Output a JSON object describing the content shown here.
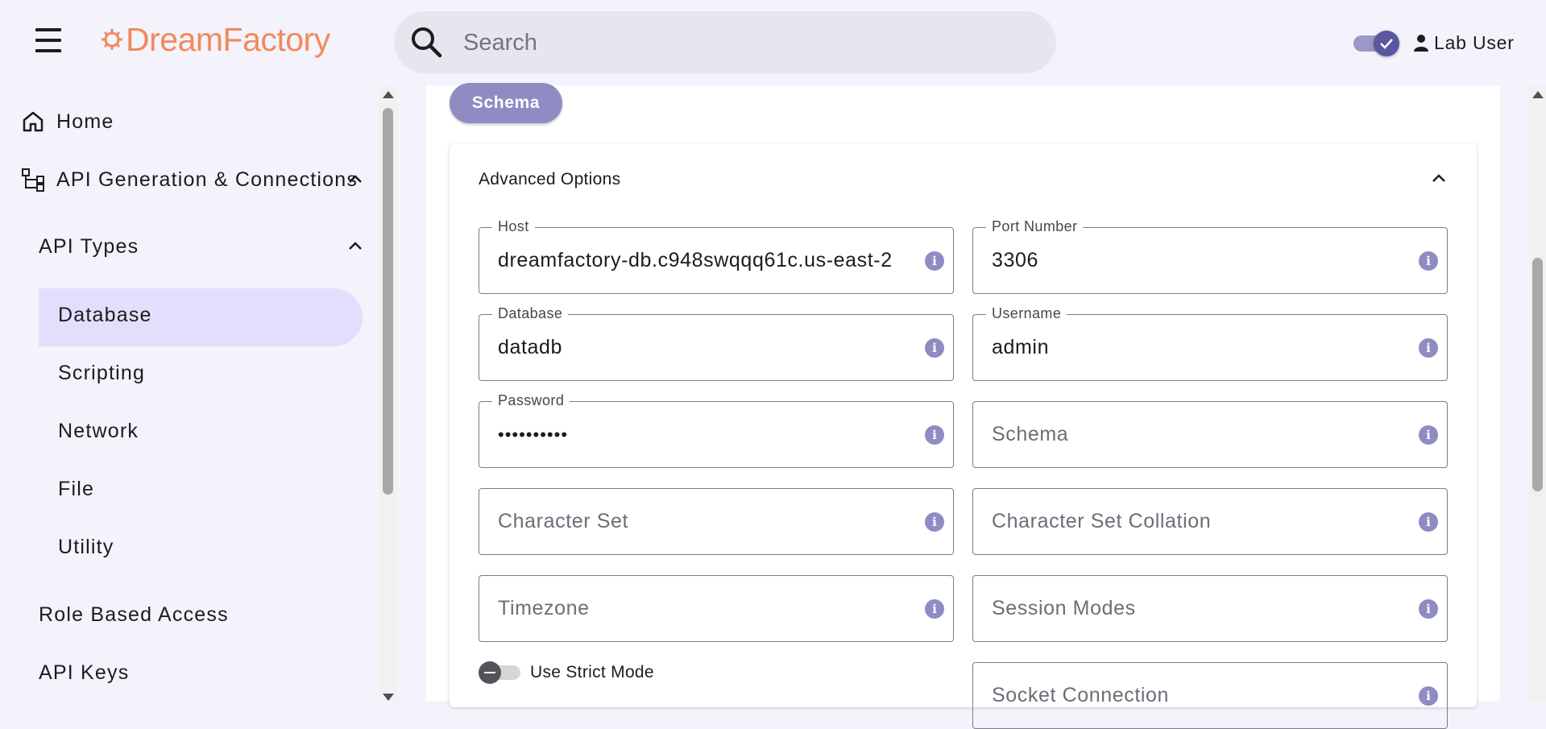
{
  "header": {
    "logo_text": "DreamFactory",
    "search_placeholder": "Search",
    "user_name": "Lab User"
  },
  "sidebar": {
    "home": "Home",
    "api_generation": "API Generation & Connections",
    "api_types": "API Types",
    "items": [
      {
        "label": "Database",
        "active": true
      },
      {
        "label": "Scripting"
      },
      {
        "label": "Network"
      },
      {
        "label": "File"
      },
      {
        "label": "Utility"
      }
    ],
    "role_based_access": "Role Based Access",
    "api_keys": "API Keys"
  },
  "main": {
    "schema_button": "Schema",
    "advanced_options_title": "Advanced Options",
    "fields": {
      "host": {
        "label": "Host",
        "value": "dreamfactory-db.c948swqqq61c.us-east-2"
      },
      "port": {
        "label": "Port Number",
        "value": "3306"
      },
      "database": {
        "label": "Database",
        "value": "datadb"
      },
      "username": {
        "label": "Username",
        "value": "admin"
      },
      "password": {
        "label": "Password",
        "value": "••••••••••"
      },
      "schema": {
        "placeholder": "Schema"
      },
      "character_set": {
        "placeholder": "Character Set"
      },
      "character_set_collation": {
        "placeholder": "Character Set Collation"
      },
      "timezone": {
        "placeholder": "Timezone"
      },
      "session_modes": {
        "placeholder": "Session Modes"
      },
      "socket_connection": {
        "placeholder": "Socket Connection"
      }
    },
    "strict_mode_label": "Use Strict Mode",
    "strict_mode_on": false
  },
  "colors": {
    "brand_orange": "#f08a5d",
    "accent_purple": "#8e8cc2",
    "active_nav_bg": "#e1dffb",
    "background": "#f4f2fb"
  },
  "icons": {
    "menu": "hamburger-icon",
    "search": "search-icon",
    "home": "home-icon",
    "api": "hierarchy-icon",
    "user": "person-icon",
    "info": "info-icon"
  }
}
